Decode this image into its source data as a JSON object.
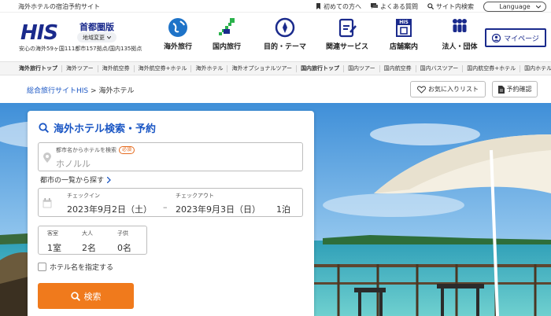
{
  "util": {
    "tagline": "海外ホテルの宿泊予約サイト",
    "links": [
      "初めての方へ",
      "よくある質問",
      "サイト内検索"
    ],
    "language": "Language"
  },
  "header": {
    "logo": "HIS",
    "region": "首都圏版",
    "region_button": "地域変更",
    "stats": "安心の海外59ヶ国111都市157拠点/国内135拠点",
    "nav": [
      "海外旅行",
      "国内旅行",
      "目的・テーマ",
      "関連サービス",
      "店舗案内",
      "法人・団体"
    ],
    "mypage": "マイページ"
  },
  "subnav": [
    "海外旅行トップ",
    "海外ツアー",
    "海外航空券",
    "海外航空券+ホテル",
    "海外ホテル",
    "海外オプショナルツアー",
    "国内旅行トップ",
    "国内ツアー",
    "国内航空券",
    "国内バスツアー",
    "国内航空券+ホテル",
    "国内ホテル"
  ],
  "breadcrumb": {
    "home": "総合旅行サイトHIS",
    "separator": ">",
    "current": "海外ホテル"
  },
  "buttons": {
    "favorites": "お気に入りリスト",
    "reservation": "予約確認"
  },
  "search": {
    "title": "海外ホテル検索・予約",
    "destination_label": "都市名からホテルを検索",
    "required": "必須",
    "destination_placeholder": "ホノルル",
    "city_list": "都市の一覧から探す",
    "checkin_label": "チェックイン",
    "checkin_value": "2023年9月2日（土）",
    "date_dash": "–",
    "checkout_label": "チェックアウト",
    "checkout_value": "2023年9月3日（日）",
    "nights": "1泊",
    "rooms_label": "客室",
    "rooms_value": "1室",
    "adults_label": "大人",
    "adults_value": "2名",
    "children_label": "子供",
    "children_value": "0名",
    "hotel_name_option": "ホテル名を指定する",
    "search_button": "検索"
  },
  "colors": {
    "brand": "#1a2a8c",
    "accent": "#f07a1c",
    "link": "#1a56c4"
  }
}
